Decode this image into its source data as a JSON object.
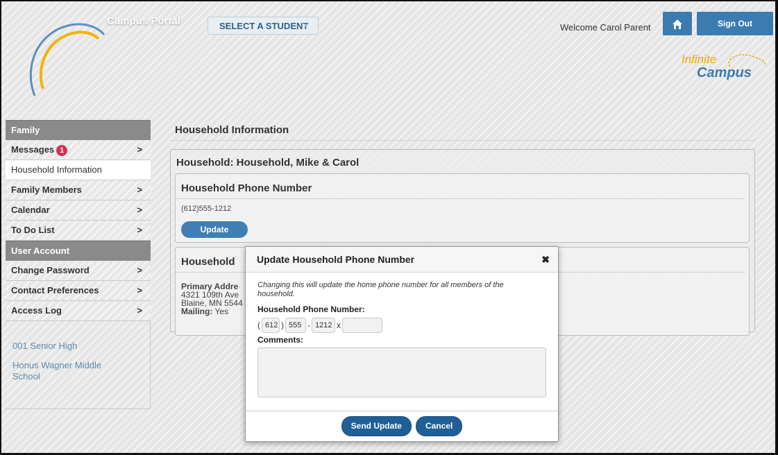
{
  "header": {
    "portal_title": "Campus Portal",
    "student_select": "SELECT A STUDENT",
    "welcome": "Welcome Carol Parent",
    "home_icon": "house-icon",
    "sign_out": "Sign Out",
    "brand_top": "Infinite",
    "brand_bottom": "Campus",
    "accent_color": "#3c7bb0",
    "logo_color": "#f0a900"
  },
  "sidebar": {
    "family_heading": "Family",
    "messages_label": "Messages",
    "messages_badge": "1",
    "family_items": [
      {
        "label": "Household Information",
        "active": true
      },
      {
        "label": "Family Members"
      },
      {
        "label": "Calendar"
      },
      {
        "label": "To Do List"
      }
    ],
    "account_heading": "User Account",
    "account_items": [
      {
        "label": "Change Password"
      },
      {
        "label": "Contact Preferences"
      },
      {
        "label": "Access Log"
      }
    ],
    "chevron": ">",
    "schools": [
      "001 Senior High",
      "Honus Wagner Middle School"
    ]
  },
  "main": {
    "page_title": "Household Information",
    "household_title": "Household: Household, Mike & Carol",
    "phone_section_title": "Household Phone Number",
    "phone_value": "(612)555-1212",
    "update_button": "Update",
    "address_section_title": "Household",
    "address_label": "Primary Addre",
    "address_line1": "4321 109th Ave",
    "address_line2": "Blaine, MN 5544",
    "mailing_label": "Mailing:",
    "mailing_value": "Yes"
  },
  "modal": {
    "title": "Update Household Phone Number",
    "close_icon": "close-icon",
    "note": "Changing this will update the home phone number for all members of the household.",
    "phone_label": "Household Phone Number:",
    "area_code": "612",
    "prefix": "555",
    "line": "1212",
    "ext_marker": "x",
    "extension": "",
    "comments_label": "Comments:",
    "comments_value": "",
    "send_button": "Send Update",
    "cancel_button": "Cancel",
    "button_color": "#1e5f96"
  }
}
